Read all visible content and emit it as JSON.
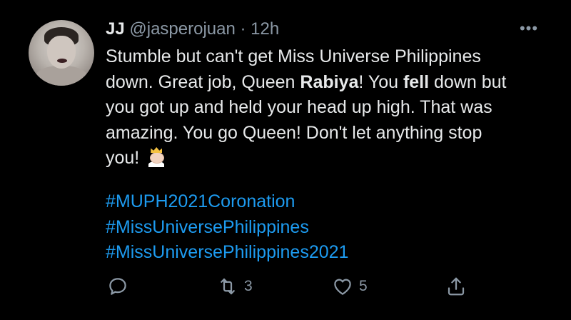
{
  "tweet": {
    "display_name": "JJ",
    "handle": "@jasperojuan",
    "separator": "·",
    "time": "12h",
    "more": "•••",
    "text": {
      "l1": "Stumble but can't get Miss Universe Philippines",
      "l2a": "down. Great job, Queen ",
      "l2b": "Rabiya",
      "l2c": "! You ",
      "l2d": "fell",
      "l2e": " down but",
      "l3": "you got up and held your head up high. That was",
      "l4": "amazing. You go Queen! Don't let anything stop",
      "l5": "you!"
    },
    "emoji": "princess-emoji",
    "hashtags": [
      "#MUPH2021Coronation",
      "#MissUniversePhilippines",
      "#MissUniversePhilippines2021"
    ],
    "actions": {
      "reply_icon": "speech-bubble-icon",
      "retweet_icon": "retweet-arrows-icon",
      "retweet_count": "3",
      "like_icon": "heart-icon",
      "like_count": "5",
      "share_icon": "share-upload-icon"
    }
  },
  "colors": {
    "background": "#000000",
    "text": "#e7e9ea",
    "muted": "#8b98a5",
    "link": "#1d9bf0"
  }
}
